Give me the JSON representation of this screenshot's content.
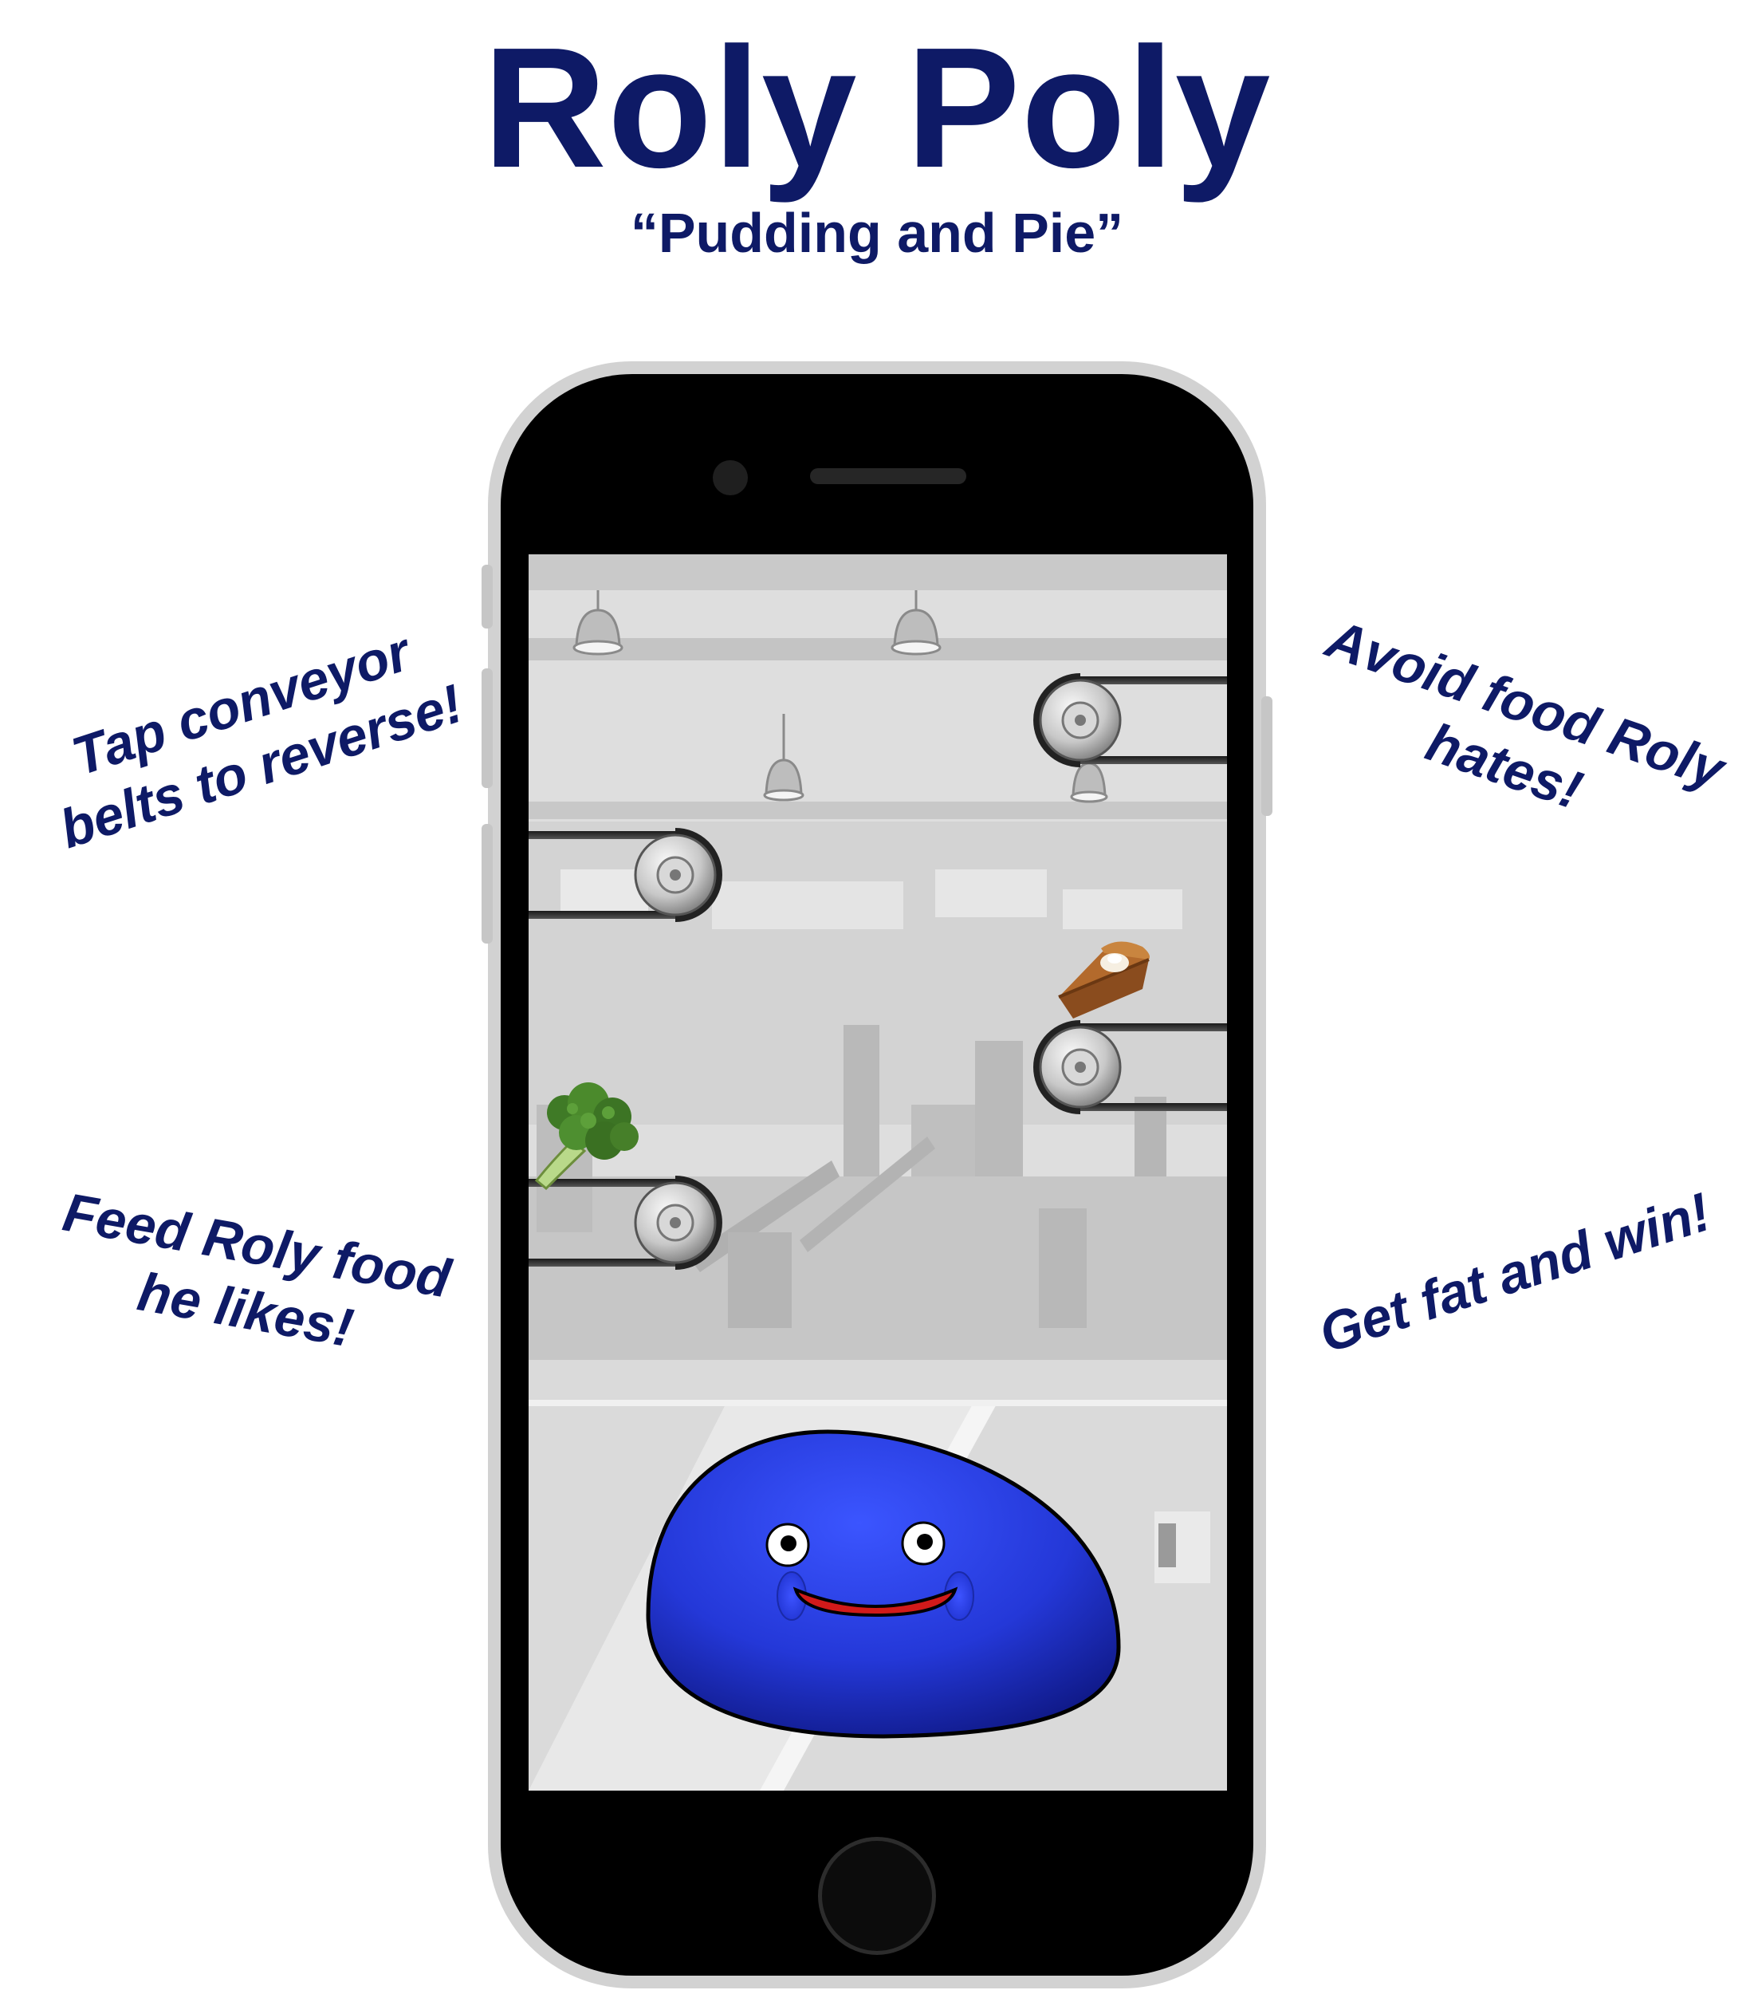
{
  "title": "Roly Poly",
  "subtitle": "“Pudding and Pie”",
  "tips": {
    "tap": [
      "Tap conveyor",
      "belts to reverse!"
    ],
    "avoid": [
      "Avoid food Roly",
      "hates!"
    ],
    "feed": [
      "Feed Roly food",
      "he likes!"
    ],
    "fat": [
      "Get fat and win!"
    ]
  },
  "colors": {
    "text": "#0e1a66",
    "roly_body": "#2b3fe6",
    "roly_mouth": "#d11a1a",
    "phone_frame": "#d2d2d2",
    "phone_face": "#000000"
  },
  "game": {
    "conveyor_count": 4,
    "food_items": [
      "broccoli",
      "pie"
    ],
    "character": "roly-poly"
  }
}
